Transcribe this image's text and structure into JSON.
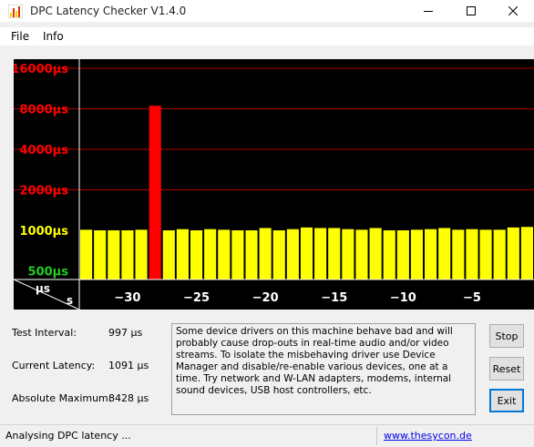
{
  "window": {
    "title": "DPC Latency Checker V1.4.0"
  },
  "menu": {
    "items": [
      "File",
      "Info"
    ]
  },
  "chart_data": {
    "type": "bar",
    "x": [
      -33,
      -32,
      -31,
      -30,
      -29,
      -28,
      -27,
      -26,
      -25,
      -24,
      -23,
      -22,
      -21,
      -20,
      -19,
      -18,
      -17,
      -16,
      -15,
      -14,
      -13,
      -12,
      -11,
      -10,
      -9,
      -8,
      -7,
      -6,
      -5,
      -4,
      -3,
      -2,
      -1
    ],
    "values": [
      1010,
      1000,
      1000,
      1000,
      1010,
      8428,
      1000,
      1020,
      1000,
      1020,
      1010,
      1000,
      1000,
      1040,
      1000,
      1020,
      1050,
      1040,
      1040,
      1020,
      1010,
      1040,
      1000,
      1000,
      1010,
      1020,
      1040,
      1010,
      1020,
      1010,
      1010,
      1050,
      1060
    ],
    "bar_colors": {
      "normal": "#ffff00",
      "high": "#ff0000",
      "threshold": 2000
    },
    "y_ticks": [
      {
        "value": 500,
        "label": "500µs",
        "color": "#22cc22"
      },
      {
        "value": 1000,
        "label": "1000µs",
        "color": "#ffff00"
      },
      {
        "value": 2000,
        "label": "2000µs",
        "color": "#ff0000"
      },
      {
        "value": 4000,
        "label": "4000µs",
        "color": "#ff0000"
      },
      {
        "value": 8000,
        "label": "8000µs",
        "color": "#ff0000"
      },
      {
        "value": 16000,
        "label": "16000µs",
        "color": "#ff0000"
      }
    ],
    "x_ticks": [
      -30,
      -25,
      -20,
      -15,
      -10,
      -5
    ],
    "y_unit": "µs",
    "x_unit": "s",
    "y_scale": "log2",
    "grid": true
  },
  "stats": {
    "test_interval_label": "Test Interval:",
    "test_interval_value": "997 µs",
    "current_latency_label": "Current Latency:",
    "current_latency_value": "1091 µs",
    "absolute_max_label": "Absolute Maximum:",
    "absolute_max_value": "8428 µs"
  },
  "advice_text": "Some device drivers on this machine behave bad and will probably cause drop-outs in real-time audio and/or video streams. To isolate the misbehaving driver use Device Manager and disable/re-enable various devices, one at a time. Try network and W-LAN adapters, modems, internal sound devices, USB host controllers, etc.",
  "buttons": {
    "stop": "Stop",
    "reset": "Reset",
    "exit": "Exit"
  },
  "status": {
    "text": "Analysing DPC latency ...",
    "link": "www.thesycon.de"
  }
}
